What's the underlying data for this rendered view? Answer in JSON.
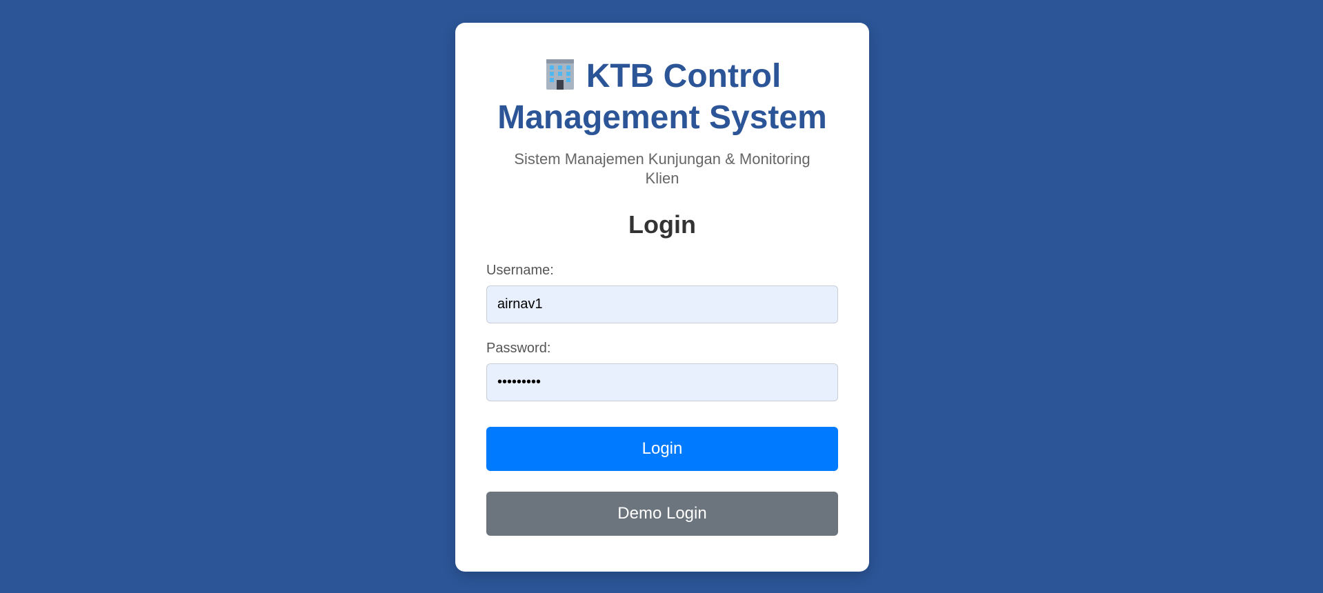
{
  "header": {
    "title": "KTB Control Management System",
    "subtitle": "Sistem Manajemen Kunjungan & Monitoring Klien",
    "icon": "office-building-icon"
  },
  "login": {
    "heading": "Login",
    "username_label": "Username:",
    "username_value": "airnav1",
    "password_label": "Password:",
    "password_value": "airnav123",
    "login_button": "Login",
    "demo_button": "Demo Login"
  },
  "colors": {
    "background": "#2b5597",
    "primary": "#007bff",
    "secondary": "#6c757d",
    "title": "#2b5597",
    "input_bg": "#e8f0fe"
  }
}
